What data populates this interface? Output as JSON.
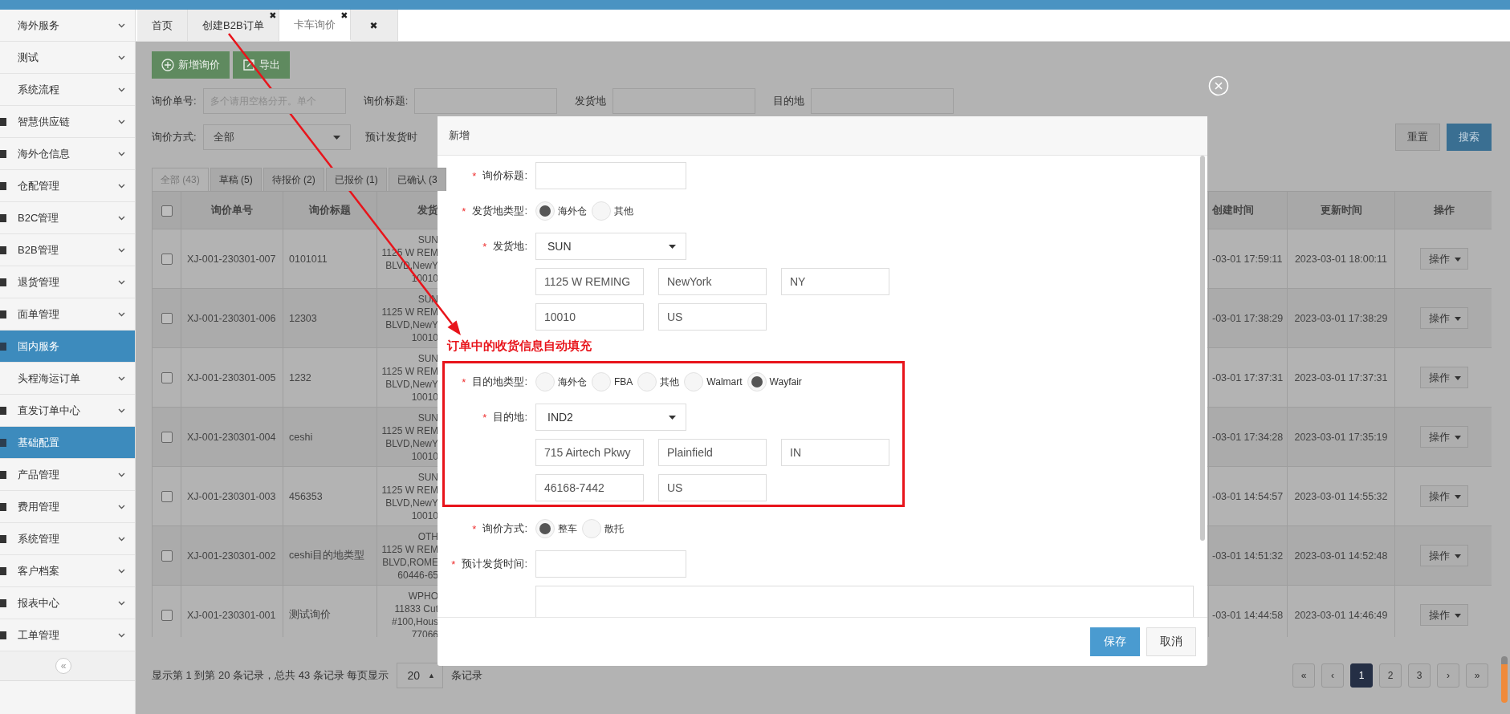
{
  "sidebar": {
    "items": [
      {
        "label": "海外服务",
        "kind": "sub"
      },
      {
        "label": "测试",
        "kind": "sub"
      },
      {
        "label": "系统流程",
        "kind": "sub"
      },
      {
        "label": "智慧供应链",
        "kind": "menu"
      },
      {
        "label": "海外仓信息",
        "kind": "menu"
      },
      {
        "label": "仓配管理",
        "kind": "menu"
      },
      {
        "label": "B2C管理",
        "kind": "menu"
      },
      {
        "label": "B2B管理",
        "kind": "menu"
      },
      {
        "label": "退货管理",
        "kind": "menu"
      },
      {
        "label": "面单管理",
        "kind": "menu"
      },
      {
        "label": "国内服务",
        "kind": "section"
      },
      {
        "label": "头程海运订单",
        "kind": "sub"
      },
      {
        "label": "直发订单中心",
        "kind": "menu"
      },
      {
        "label": "基础配置",
        "kind": "section"
      },
      {
        "label": "产品管理",
        "kind": "menu"
      },
      {
        "label": "费用管理",
        "kind": "menu"
      },
      {
        "label": "系统管理",
        "kind": "menu"
      },
      {
        "label": "客户档案",
        "kind": "menu"
      },
      {
        "label": "报表中心",
        "kind": "menu"
      },
      {
        "label": "工单管理",
        "kind": "menu"
      }
    ],
    "collapse_button": "«"
  },
  "tabs": [
    {
      "label": "首页",
      "selected": false
    },
    {
      "label": "创建B2B订单",
      "close": "✖",
      "selected": false
    },
    {
      "label": "卡车询价",
      "close": "✖",
      "selected": true
    },
    {
      "close": "✖",
      "selected": false
    }
  ],
  "toolbar": [
    {
      "label": "新增询价",
      "kind": "add"
    },
    {
      "label": "导出",
      "kind": "export"
    }
  ],
  "filter_rows": [
    [
      {
        "label": "询价单号:",
        "kind": "text",
        "placeholder": "多个请用空格分开。单个"
      },
      {
        "label": "询价标题:",
        "kind": "text"
      },
      {
        "label": "发货地",
        "kind": "text"
      },
      {
        "label": "目的地",
        "kind": "text"
      }
    ],
    [
      {
        "label": "询价方式:",
        "kind": "select",
        "value": "全部"
      },
      {
        "label": "预计发货时",
        "kind": "label"
      }
    ]
  ],
  "search_buttons": [
    {
      "label": "重置",
      "kind": "default"
    },
    {
      "label": "搜索",
      "kind": "primary"
    }
  ],
  "status_tabs": [
    {
      "label": "全部 (43)",
      "selected": true
    },
    {
      "label": "草稿 (5)",
      "selected": false
    },
    {
      "label": "待报价 (2)",
      "selected": false
    },
    {
      "label": "已报价 (1)",
      "selected": false
    },
    {
      "label": "已确认 (3",
      "selected": false
    }
  ],
  "table": {
    "header_checked": false,
    "columns": [
      "询价单号",
      "询价标题",
      "发货",
      "创建时间",
      "更新时间",
      "操作"
    ],
    "rows": [
      {
        "checked": false,
        "id": "XJ-001-230301-007",
        "title": "0101011",
        "origin": [
          "SUN",
          "1125 W REM",
          "BLVD,NewY",
          "10010"
        ],
        "created": "-03-01 17:59:11",
        "updated": "2023-03-01 18:00:11",
        "action": "操作"
      },
      {
        "checked": false,
        "id": "XJ-001-230301-006",
        "title": "12303",
        "origin": [
          "SUN",
          "1125 W REM",
          "BLVD,NewY",
          "10010"
        ],
        "created": "-03-01 17:38:29",
        "updated": "2023-03-01 17:38:29",
        "action": "操作"
      },
      {
        "checked": false,
        "id": "XJ-001-230301-005",
        "title": "1232",
        "origin": [
          "SUN",
          "1125 W REM",
          "BLVD,NewY",
          "10010"
        ],
        "created": "-03-01 17:37:31",
        "updated": "2023-03-01 17:37:31",
        "action": "操作"
      },
      {
        "checked": false,
        "id": "XJ-001-230301-004",
        "title": "ceshi",
        "origin": [
          "SUN",
          "1125 W REM",
          "BLVD,NewY",
          "10010"
        ],
        "created": "-03-01 17:34:28",
        "updated": "2023-03-01 17:35:19",
        "action": "操作"
      },
      {
        "checked": false,
        "id": "XJ-001-230301-003",
        "title": "456353",
        "origin": [
          "SUN",
          "1125 W REM",
          "BLVD,NewY",
          "10010"
        ],
        "created": "-03-01 14:54:57",
        "updated": "2023-03-01 14:55:32",
        "action": "操作"
      },
      {
        "checked": false,
        "id": "XJ-001-230301-002",
        "title": "ceshi目的地类型",
        "origin": [
          "OTH",
          "1125 W REM",
          "BLVD,ROME",
          "60446-65"
        ],
        "created": "-03-01 14:51:32",
        "updated": "2023-03-01 14:52:48",
        "action": "操作"
      },
      {
        "checked": false,
        "id": "XJ-001-230301-001",
        "title": "测试询价",
        "origin": [
          "WPHO",
          "11833 Cut",
          "#100,Hous",
          "77066"
        ],
        "created": "-03-01 14:44:58",
        "updated": "2023-03-01 14:46:49",
        "action": "操作"
      }
    ]
  },
  "pagination": {
    "summary": "显示第 1 到第 20 条记录，总共 43 条记录 每页显示",
    "page_size": "20",
    "page_size_arrow": "▲",
    "suffix": "条记录",
    "pages": [
      {
        "label": "«",
        "selected": false
      },
      {
        "label": "‹",
        "selected": false
      },
      {
        "label": "1",
        "selected": true
      },
      {
        "label": "2",
        "selected": false
      },
      {
        "label": "3",
        "selected": false
      },
      {
        "label": "›",
        "selected": false
      },
      {
        "label": "»",
        "selected": false
      }
    ]
  },
  "modal": {
    "title": "新增",
    "origin_fields": [
      {
        "kind": "text",
        "mark": "*",
        "label": "询价标题:"
      },
      {
        "kind": "radio",
        "mark": "*",
        "label": "发货地类型:",
        "options": [
          {
            "label": "海外仓",
            "selected": true
          },
          {
            "label": "其他",
            "selected": false
          }
        ]
      },
      {
        "kind": "select",
        "mark": "*",
        "label": "发货地:",
        "value": "SUN"
      },
      {
        "kind": "inputs",
        "values": [
          "1125 W REMING",
          "NewYork",
          "NY"
        ]
      },
      {
        "kind": "inputs",
        "values": [
          "10010",
          "US"
        ]
      }
    ],
    "annotation": "订单中的收货信息自动填充",
    "destination_fields": [
      {
        "kind": "radio",
        "mark": "*",
        "label": "目的地类型:",
        "options": [
          {
            "label": "海外仓",
            "selected": false
          },
          {
            "label": "FBA",
            "selected": false
          },
          {
            "label": "其他",
            "selected": false
          },
          {
            "label": "Walmart",
            "selected": false
          },
          {
            "label": "Wayfair",
            "selected": true
          }
        ]
      },
      {
        "kind": "select",
        "mark": "*",
        "label": "目的地:",
        "value": "IND2"
      },
      {
        "kind": "inputs",
        "values": [
          "715 Airtech Pkwy",
          "Plainfield",
          "IN"
        ]
      },
      {
        "kind": "inputs",
        "values": [
          "46168-7442",
          "US"
        ]
      }
    ],
    "other_fields": [
      {
        "kind": "radio",
        "mark": "*",
        "label": "询价方式:",
        "options": [
          {
            "label": "整车",
            "selected": true
          },
          {
            "label": "散托",
            "selected": false
          }
        ]
      },
      {
        "kind": "text",
        "mark": "*",
        "label": "预计发货时间:"
      },
      {
        "kind": "textarea"
      }
    ],
    "buttons": [
      {
        "label": "保存",
        "kind": "primary"
      },
      {
        "label": "取消",
        "kind": "default"
      }
    ]
  }
}
